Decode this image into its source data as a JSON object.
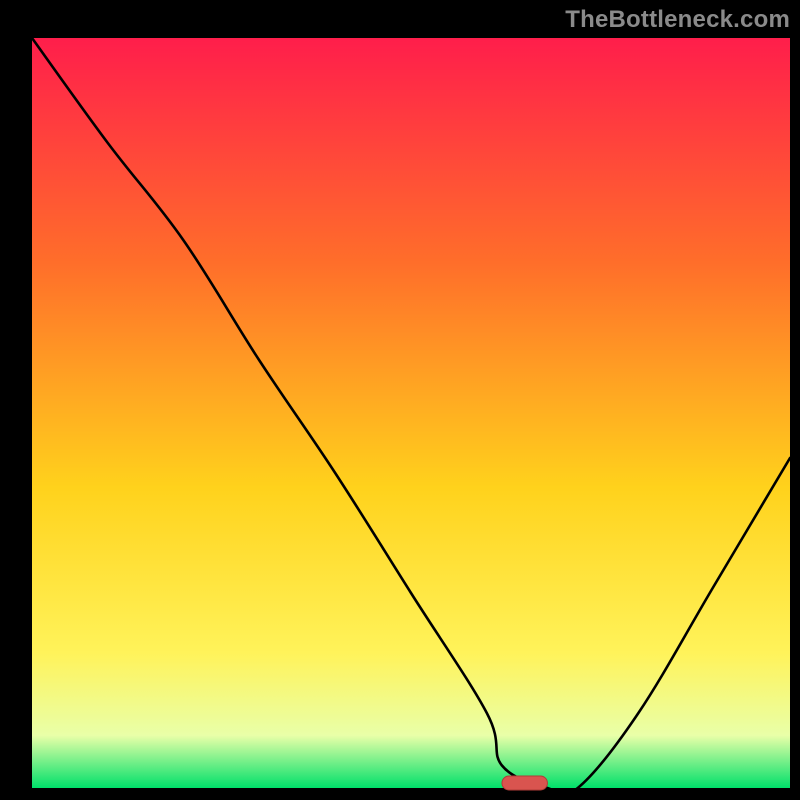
{
  "watermark": "TheBottleneck.com",
  "colors": {
    "black": "#000000",
    "grad_top": "#ff1e4b",
    "grad_mid1": "#ff6e2a",
    "grad_mid2": "#ffd21c",
    "grad_mid3": "#fff35a",
    "grad_mid4": "#e9ffa8",
    "grad_bottom": "#00e06a",
    "curve": "#000000",
    "marker_fill": "#d9544f",
    "marker_stroke": "#b03b37"
  },
  "chart_data": {
    "type": "line",
    "title": "",
    "xlabel": "",
    "ylabel": "",
    "xlim": [
      0,
      100
    ],
    "ylim": [
      0,
      100
    ],
    "x": [
      0,
      10,
      20,
      30,
      40,
      50,
      60,
      62,
      68,
      72,
      80,
      90,
      100
    ],
    "values": [
      100,
      86,
      73,
      57,
      42,
      26,
      10,
      3,
      0,
      0,
      10,
      27,
      44
    ],
    "marker": {
      "x": 65,
      "y": 0,
      "width": 6,
      "height": 2
    }
  }
}
